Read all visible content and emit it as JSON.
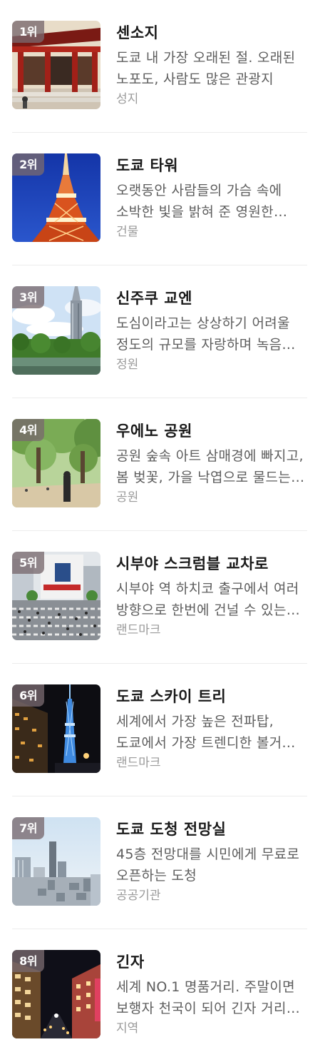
{
  "items": [
    {
      "rank": "1위",
      "title": "센소지",
      "desc": "도쿄 내 가장 오래된 절. 오래된 노포도, 사람도 많은 관광지",
      "category": "성지"
    },
    {
      "rank": "2위",
      "title": "도쿄 타워",
      "desc": "오랫동안 사람들의 가슴 속에 소박한 빛을 밝혀 준 영원한 랜드마크",
      "category": "건물"
    },
    {
      "rank": "3위",
      "title": "신주쿠 교엔",
      "desc": "도심이라고는 상상하기 어려울 정도의 규모를 자랑하며 녹음이 우거진 정원",
      "category": "정원"
    },
    {
      "rank": "4위",
      "title": "우에노 공원",
      "desc": "공원 숲속 아트 삼매경에 빠지고, 봄 벚꽃, 가을 낙엽으로 물드는 공원",
      "category": "공원"
    },
    {
      "rank": "5위",
      "title": "시부야 스크럼블 교차로",
      "desc": "시부야 역 하치코 출구에서 여러 방향으로 한번에 건널 수 있는 교차로",
      "category": "랜드마크"
    },
    {
      "rank": "6위",
      "title": "도쿄 스카이 트리",
      "desc": "세계에서 가장 높은 전파탑, 도쿄에서 가장 트렌디한 볼거리가 가득한 곳",
      "category": "랜드마크"
    },
    {
      "rank": "7위",
      "title": "도쿄 도청 전망실",
      "desc": "45층 전망대를 시민에게 무료로 오픈하는 도청",
      "category": "공공기관"
    },
    {
      "rank": "8위",
      "title": "긴자",
      "desc": "세계 NO.1 명품거리. 주말이면 보행자 천국이 되어 긴자 거리를 걸을 수 있는 곳",
      "category": "지역"
    }
  ]
}
